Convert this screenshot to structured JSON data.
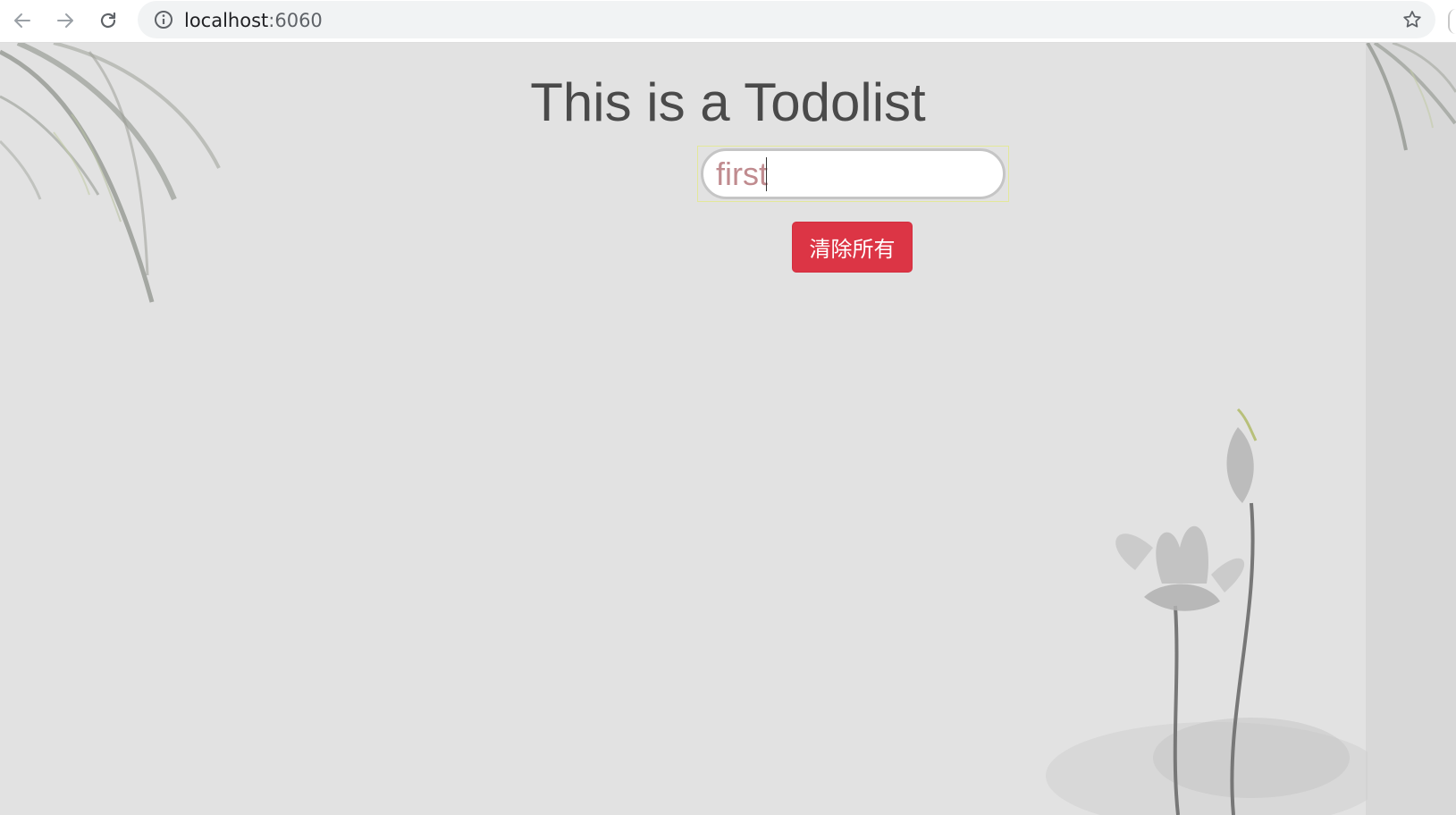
{
  "browser": {
    "url_host": "localhost",
    "url_port": ":6060",
    "icons": [
      "back-arrow-icon",
      "forward-arrow-icon",
      "reload-icon",
      "info-icon",
      "star-icon"
    ]
  },
  "page": {
    "title": "This is a Todolist",
    "input_value": "first",
    "clear_button_label": "清除所有"
  },
  "colors": {
    "background": "#e2e2e2",
    "title_text": "#4a4a4a",
    "input_text": "#c08b8f",
    "clear_button": "#dc3545"
  }
}
